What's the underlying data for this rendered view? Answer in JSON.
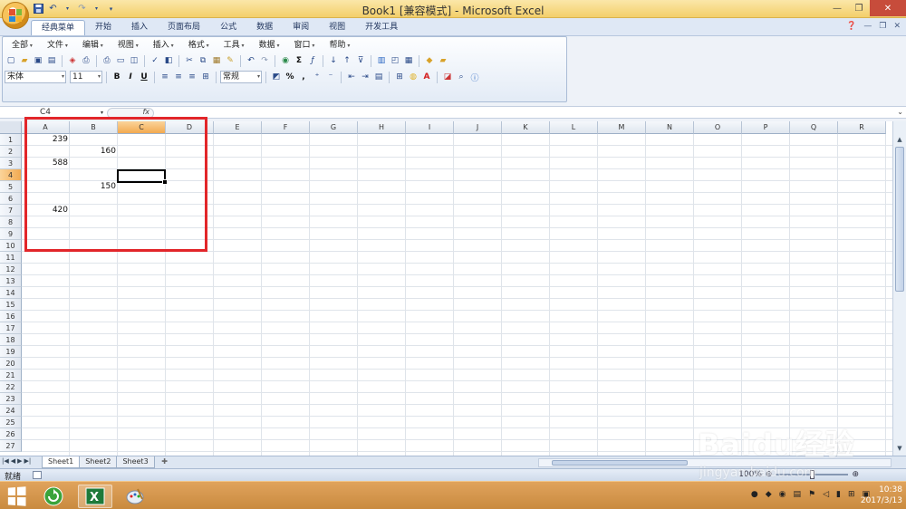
{
  "window": {
    "title": "Book1  [兼容模式] - Microsoft Excel"
  },
  "ribbon_tabs": [
    {
      "label": "经典菜单",
      "active": true
    },
    {
      "label": "开始"
    },
    {
      "label": "插入"
    },
    {
      "label": "页面布局"
    },
    {
      "label": "公式"
    },
    {
      "label": "数据"
    },
    {
      "label": "审阅"
    },
    {
      "label": "视图"
    },
    {
      "label": "开发工具"
    }
  ],
  "classic_menu": [
    "全部",
    "文件",
    "编辑",
    "视图",
    "插入",
    "格式",
    "工具",
    "数据",
    "窗口",
    "帮助"
  ],
  "toolbar": {
    "font_name": "宋体",
    "font_size": "11",
    "bold": "B",
    "italic": "I",
    "underline": "U",
    "number_format": "常规",
    "percent": "%",
    "comma": ","
  },
  "formula_bar": {
    "name_box": "C4",
    "fx": "fx",
    "formula": ""
  },
  "columns": [
    "A",
    "B",
    "C",
    "D",
    "E",
    "F",
    "G",
    "H",
    "I",
    "J",
    "K",
    "L",
    "M",
    "N",
    "O",
    "P",
    "Q",
    "R"
  ],
  "rows": [
    "1",
    "2",
    "3",
    "4",
    "5",
    "6",
    "7",
    "8",
    "9",
    "10",
    "11",
    "12",
    "13",
    "14",
    "15",
    "16",
    "17",
    "18",
    "19",
    "20",
    "21",
    "22",
    "23",
    "24",
    "25",
    "26",
    "27"
  ],
  "selected": {
    "column": "C",
    "row": "4"
  },
  "cells": [
    {
      "ref": "A1",
      "value": "239"
    },
    {
      "ref": "B2",
      "value": "160"
    },
    {
      "ref": "A3",
      "value": "588"
    },
    {
      "ref": "B5",
      "value": "150"
    },
    {
      "ref": "A7",
      "value": "420"
    }
  ],
  "sheets": [
    {
      "label": "Sheet1",
      "active": true
    },
    {
      "label": "Sheet2"
    },
    {
      "label": "Sheet3"
    }
  ],
  "status": {
    "ready": "就绪",
    "zoom": "100%"
  },
  "taskbar": {
    "time": "10:38",
    "date": "2017/3/13"
  },
  "watermark": {
    "brand": "Baidu经验",
    "site": "jingyan.baidu.com"
  },
  "colors": {
    "highlight_box": "#e2262a",
    "selected_header": "#f2a950",
    "taskbar": "#d3944b"
  }
}
